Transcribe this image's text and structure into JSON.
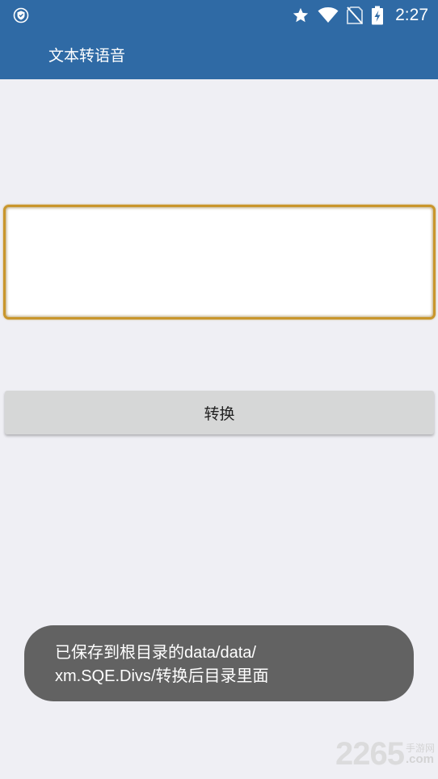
{
  "status_bar": {
    "time": "2:27",
    "icons": [
      "shield-icon",
      "star-icon",
      "wifi-icon",
      "no-sim-icon",
      "battery-charging-icon"
    ]
  },
  "app_bar": {
    "title": "文本转语音"
  },
  "text_input": {
    "value": "",
    "placeholder": ""
  },
  "convert_button": {
    "label": "转换"
  },
  "toast": {
    "line1": "已保存到根目录的data/data/",
    "line2": "xm.SQE.Divs/转换后目录里面"
  },
  "watermark": {
    "number": "2265",
    "cn": "手游网",
    "domain": ".com"
  },
  "colors": {
    "primary": "#2f6aa5",
    "background": "#efeff4",
    "focus_border": "#c9962c",
    "button_bg": "#d6d7d7",
    "toast_bg": "#626262"
  }
}
